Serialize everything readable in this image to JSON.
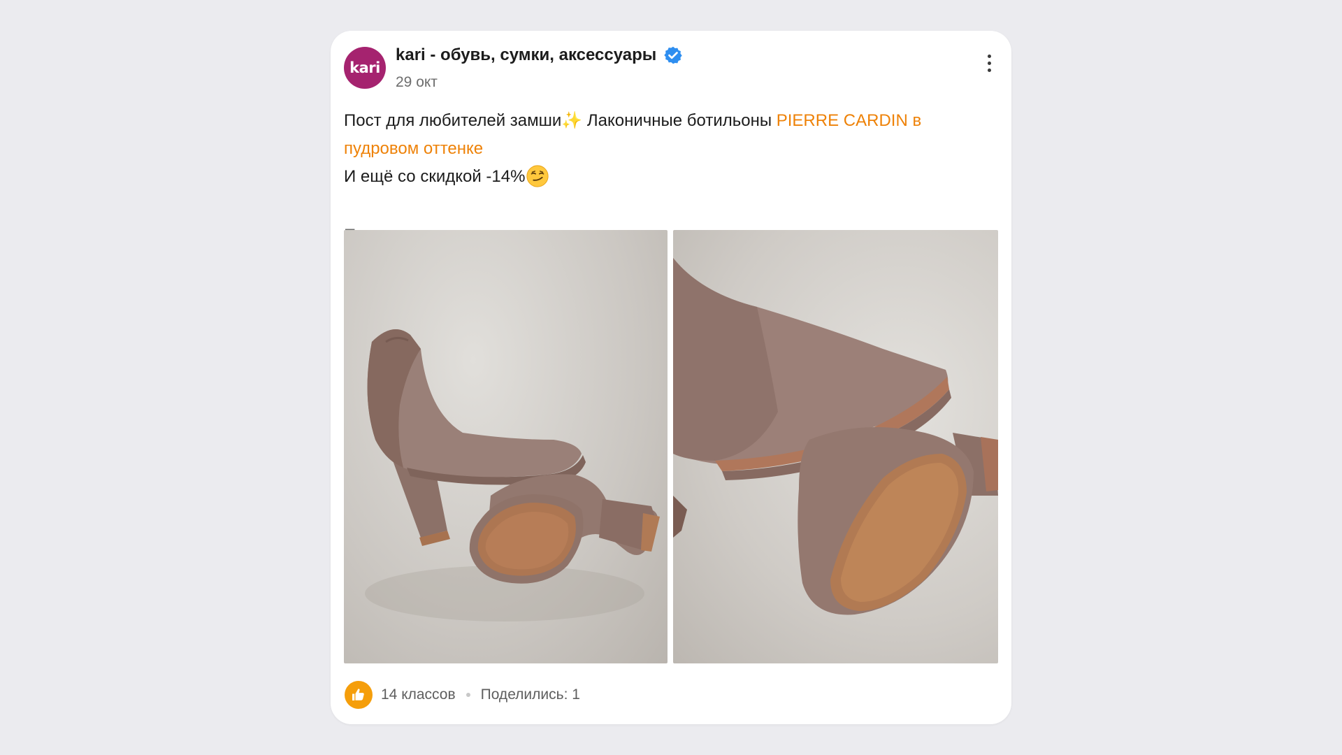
{
  "post": {
    "author": {
      "name": "kari - обувь, сумки, аксессуары",
      "avatar_text": "kari",
      "verified_icon": "verified-check-icon",
      "avatar_color": "#a5236f"
    },
    "date": "29 окт",
    "menu_icon": "more-vertical-icon",
    "text": {
      "line1_prefix": "Пост для любителей замши",
      "sparkle": "✨",
      "line1_middle": " Лаконичные ботильоны ",
      "link": "PIERRE CARDIN в пудровом оттенке",
      "line2": "И ещё со скидкой -14%",
      "emoji_icon": "smirking-face-icon"
    },
    "show_more": "Показать еще",
    "photos": [
      {
        "subject": "suede-ankle-boot-photo"
      },
      {
        "subject": "suede-boot-sole-closeup-photo"
      }
    ],
    "footer": {
      "like_icon": "thumbs-up-icon",
      "likes": "14 классов",
      "shares": "Поделились: 1"
    },
    "colors": {
      "link": "#ee8208",
      "verified": "#2e8ef0",
      "like": "#f59e0b",
      "background": "#ebebef"
    }
  }
}
